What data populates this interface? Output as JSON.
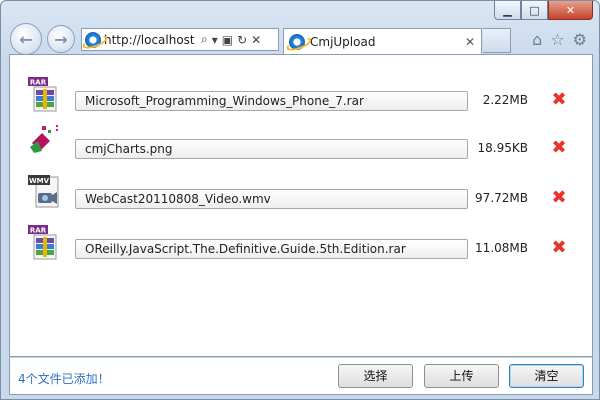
{
  "browser": {
    "url": "http://localhost:",
    "tab_title": "CmjUpload",
    "caption": {
      "minimize": "▁",
      "maximize": "□",
      "close": "✕"
    },
    "nav": {
      "back": "←",
      "forward": "→"
    },
    "addr_tools": {
      "search": "⌕",
      "dropdown": "▾",
      "compat": "▣",
      "refresh": "↻",
      "stop": "✕"
    },
    "tab_close": "✕",
    "toolbar": {
      "home": "⌂",
      "favorites": "☆",
      "settings": "⚙"
    }
  },
  "files": [
    {
      "type_label": "RAR",
      "icon": "rar-archive-icon",
      "name": "Microsoft_Programming_Windows_Phone_7.rar",
      "size": "2.22MB"
    },
    {
      "type_label": "",
      "icon": "png-image-icon",
      "name": "cmjCharts.png",
      "size": "18.95KB"
    },
    {
      "type_label": "WMV",
      "icon": "wmv-video-icon",
      "name": "WebCast20110808_Video.wmv",
      "size": "97.72MB"
    },
    {
      "type_label": "RAR",
      "icon": "rar-archive-icon",
      "name": "OReilly.JavaScript.The.Definitive.Guide.5th.Edition.rar",
      "size": "11.08MB"
    }
  ],
  "delete_glyph": "✖",
  "status": {
    "message": "4个文件已添加！"
  },
  "buttons": {
    "select": "选择",
    "upload": "上传",
    "clear": "清空"
  },
  "colors": {
    "delete": "#e8342a",
    "status_text": "#2f6fc0",
    "rar_label": "#7a2c86",
    "wmv_label": "#3a3a3a"
  }
}
